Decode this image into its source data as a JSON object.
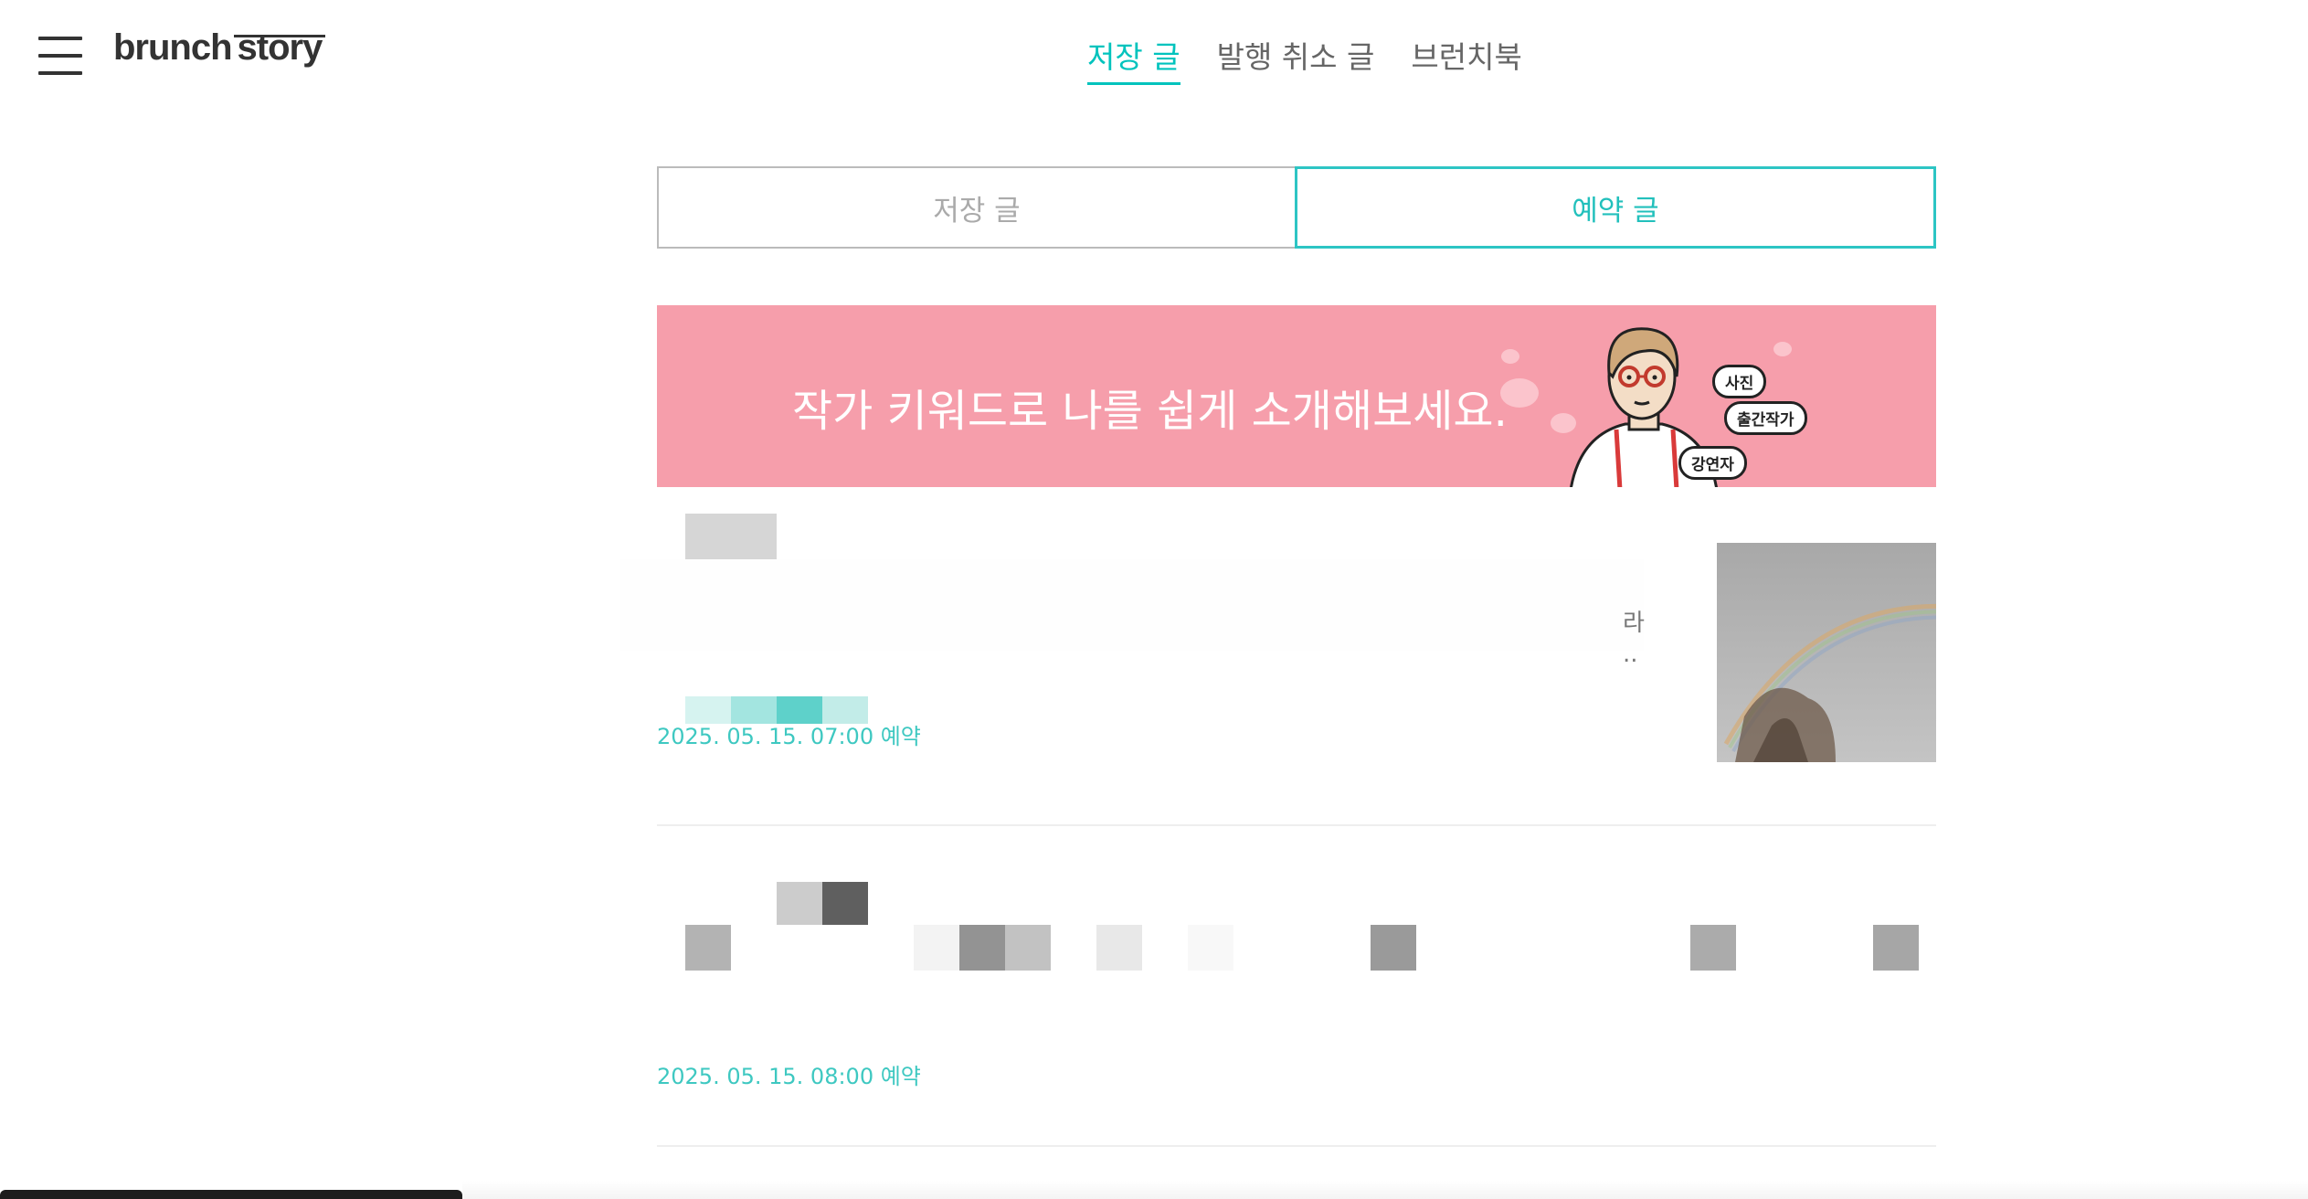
{
  "header": {
    "logo_brunch": "brunch",
    "logo_story": "story",
    "nav": [
      {
        "label": "저장 글",
        "active": true
      },
      {
        "label": "발행 취소 글",
        "active": false
      },
      {
        "label": "브런치북",
        "active": false
      }
    ]
  },
  "tabs": [
    {
      "label": "저장 글",
      "active": false
    },
    {
      "label": "예약 글",
      "active": true
    }
  ],
  "banner": {
    "text": "작가 키워드로 나를 쉽게 소개해보세요.",
    "keywords": [
      "사진",
      "출간작가",
      "강연자"
    ],
    "background": "#f69eab"
  },
  "posts": [
    {
      "snippet_line1": "라",
      "snippet_line2": "..",
      "date": "2025. 05. 15. 07:00 예약",
      "has_thumbnail": true,
      "thumbnail": "rainbow-photo"
    },
    {
      "date": "2025. 05. 15. 08:00 예약",
      "has_thumbnail": false
    }
  ],
  "colors": {
    "accent": "#00c3bd",
    "date": "#3ec8c1",
    "banner": "#f69eab",
    "text": "#333333"
  },
  "icons": {
    "menu": "hamburger-menu-icon"
  }
}
